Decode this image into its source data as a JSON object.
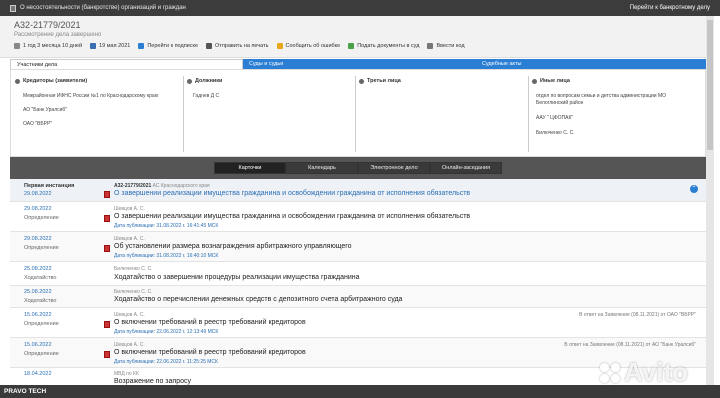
{
  "topbar": {
    "title": "О несостоятельности (банкротстве) организаций и граждан",
    "right_link": "Перейти к банкротному делу"
  },
  "case": {
    "number": "А32-21779/2021",
    "status": "Рассмотрение дела завершено"
  },
  "toolbar": [
    {
      "label": "1 год 3 месяца 10 дней",
      "icon": "clock-icon"
    },
    {
      "label": "19 мая 2021",
      "icon": "calendar-icon"
    },
    {
      "label": "Перейти к подписке",
      "icon": "shield-icon"
    },
    {
      "label": "Отправить на печать",
      "icon": "print-icon"
    },
    {
      "label": "Сообщить об ошибке",
      "icon": "warning-icon"
    },
    {
      "label": "Подать документы в суд",
      "icon": "upload-icon"
    },
    {
      "label": "Ввести код",
      "icon": "code-icon"
    }
  ],
  "tabs": [
    "Участники дела",
    "Суды и судьи",
    "Судебные акты"
  ],
  "participants": {
    "plaintiffs": {
      "title": "Кредиторы (заявители)",
      "items": [
        "Межрайонная ИФНС России №1 по Краснодарскому краю",
        "АО \"Банк Уралсиб\"",
        "ОАО \"ВБРР\""
      ]
    },
    "defendants": {
      "title": "Должники",
      "items": [
        "Гаднев Д С"
      ]
    },
    "third": {
      "title": "Третьи лица",
      "items": []
    },
    "others": {
      "title": "Иные лица",
      "items": [
        "отдел по вопросам семьи и детства администрации МО Белоглинский район",
        "ААУ \" ЦФОПАК\"",
        "Билюченко С. С."
      ]
    }
  },
  "nav": [
    "Карточки",
    "Календарь",
    "Электронное дело",
    "Онлайн-заседания"
  ],
  "first": {
    "kind": "Первая инстанция",
    "date": "29.08.2022",
    "number": "А32-21779/2021",
    "court": "АС Краснодарского края",
    "title": "О завершении реализации имущества гражданина и освобождении гражданина от исполнения обязательств"
  },
  "rows": [
    {
      "date": "29.08.2022",
      "kind": "Определение",
      "judge": "Шевцов А. С.",
      "title": "О завершении реализации имущества гражданина и освобождении гражданина от исполнения обязательств",
      "pub": "Дата публикации: 31.08.2022 г. 16:41:45 МСК",
      "note": ""
    },
    {
      "date": "29.08.2022",
      "kind": "Определение",
      "judge": "Шевцов А. С.",
      "title": "Об установлении размера вознаграждения арбитражного управляющего",
      "pub": "Дата публикации: 31.08.2022 г. 16:40:10 МСК",
      "note": ""
    },
    {
      "date": "25.08.2022",
      "kind": "Ходатайство",
      "judge": "Билюченко С. С.",
      "title": "Ходатайство о завершении процедуры реализации имущества гражданина",
      "pub": "",
      "note": ""
    },
    {
      "date": "25.08.2022",
      "kind": "Ходатайство",
      "judge": "Билюченко С. С.",
      "title": "Ходатайство о перечислении денежных средств с депозитного счета арбитражного суда",
      "pub": "",
      "note": ""
    },
    {
      "date": "15.06.2022",
      "kind": "Определение",
      "judge": "Шевцов А. С.",
      "title": "О включении требований в реестр требований кредиторов",
      "pub": "Дата публикации: 22.06.2022 г. 12:13:49 МСК",
      "note": "В ответ на Заявление (08.11.2021) от ОАО \"ВБРР\""
    },
    {
      "date": "15.06.2022",
      "kind": "Определение",
      "judge": "Шевцов А. С.",
      "title": "О включении требований в реестр требований кредиторов",
      "pub": "Дата публикации: 22.06.2022 г. 11:25:25 МСК",
      "note": "В ответ на Заявление (08.11.2021) от АО \"Банк Уралсиб\""
    },
    {
      "date": "18.04.2022",
      "kind": "",
      "judge": "МВД по КК",
      "title": "Возражение по запросу",
      "pub": "",
      "note": ""
    }
  ],
  "footer": "PRAVO TECH",
  "watermark": "Avito"
}
